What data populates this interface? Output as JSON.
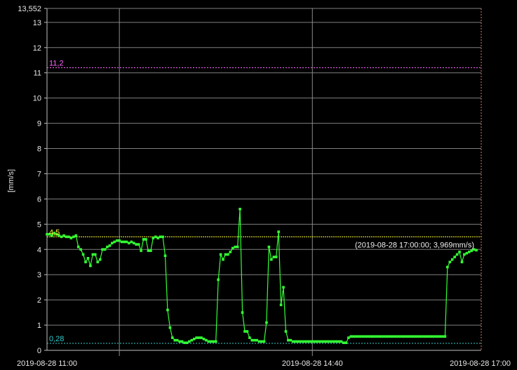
{
  "chart_data": {
    "type": "line",
    "ylabel": "[mm/s]",
    "ylim": [
      0,
      13.552
    ],
    "y_ticks": [
      0,
      1,
      2,
      3,
      4,
      5,
      6,
      7,
      8,
      9,
      10,
      11,
      12,
      13
    ],
    "y_max_label": "13,552",
    "x_range": [
      "2019-08-28 11:00",
      "2019-08-28 17:00"
    ],
    "x_ticks": [
      "2019-08-28 11:00",
      "2019-08-28 14:40",
      "2019-08-28 17:00"
    ],
    "grid": true,
    "thresholds": [
      {
        "label": "11,2",
        "value": 11.2,
        "color": "#ff66ff"
      },
      {
        "label": "4,5",
        "value": 4.5,
        "color": "#ffff33"
      },
      {
        "label": "0,28",
        "value": 0.28,
        "color": "#33cccc"
      }
    ],
    "cursor": {
      "time": "2019-08-28 17:00",
      "label": "(2019-08-28 17:00:00; 3,969mm/s)"
    },
    "series": [
      {
        "color": "#33ff33",
        "x_minutes": [
          0,
          2,
          4,
          6,
          8,
          10,
          12,
          14,
          16,
          18,
          20,
          22,
          24,
          26,
          28,
          30,
          32,
          34,
          36,
          38,
          40,
          42,
          44,
          46,
          48,
          50,
          52,
          54,
          56,
          58,
          60,
          62,
          64,
          66,
          68,
          70,
          72,
          74,
          76,
          78,
          80,
          82,
          84,
          86,
          88,
          90,
          92,
          94,
          96,
          98,
          100,
          102,
          104,
          106,
          108,
          110,
          112,
          114,
          116,
          118,
          120,
          122,
          124,
          126,
          128,
          130,
          132,
          134,
          136,
          138,
          140,
          142,
          144,
          146,
          148,
          150,
          152,
          154,
          156,
          158,
          160,
          162,
          164,
          166,
          168,
          170,
          172,
          174,
          176,
          178,
          180,
          182,
          184,
          186,
          188,
          190,
          192,
          194,
          196,
          198,
          200,
          202,
          204,
          206,
          208,
          210,
          212,
          214,
          216,
          218,
          220,
          222,
          224,
          226,
          228,
          230,
          232,
          234,
          236,
          238,
          240,
          242,
          244,
          246,
          248,
          250,
          252,
          254,
          256,
          258,
          260,
          262,
          264,
          266,
          268,
          270,
          272,
          274,
          276,
          278,
          280,
          282,
          284,
          286,
          288,
          290,
          292,
          294,
          296,
          298,
          300,
          302,
          304,
          306,
          308,
          310,
          312,
          314,
          316,
          318,
          320,
          322,
          324,
          326,
          328,
          330,
          332,
          334,
          336,
          338,
          340,
          342,
          344,
          346,
          348,
          350,
          352,
          354,
          356,
          358,
          360
        ],
        "values": [
          4.6,
          4.6,
          4.55,
          4.65,
          4.6,
          4.55,
          4.5,
          4.55,
          4.5,
          4.5,
          4.45,
          4.5,
          4.55,
          4.1,
          4.0,
          3.8,
          3.5,
          3.65,
          3.35,
          3.8,
          3.8,
          3.5,
          3.6,
          4.0,
          4.0,
          4.1,
          4.15,
          4.25,
          4.3,
          4.35,
          4.35,
          4.3,
          4.3,
          4.3,
          4.25,
          4.3,
          4.25,
          4.2,
          4.2,
          3.95,
          4.4,
          4.4,
          3.95,
          3.95,
          4.45,
          4.5,
          4.45,
          4.5,
          4.5,
          3.75,
          1.6,
          0.9,
          0.5,
          0.4,
          0.4,
          0.35,
          0.35,
          0.3,
          0.3,
          0.35,
          0.4,
          0.45,
          0.5,
          0.5,
          0.5,
          0.45,
          0.4,
          0.35,
          0.35,
          0.35,
          0.35,
          2.8,
          3.8,
          3.6,
          3.8,
          3.8,
          3.9,
          4.05,
          4.1,
          4.1,
          5.6,
          1.5,
          0.75,
          0.75,
          0.5,
          0.4,
          0.4,
          0.4,
          0.35,
          0.35,
          0.35,
          1.1,
          4.1,
          3.6,
          3.7,
          3.7,
          4.7,
          1.8,
          2.5,
          0.75,
          0.4,
          0.4,
          0.35,
          0.35,
          0.35,
          0.35,
          0.35,
          0.35,
          0.35,
          0.35,
          0.35,
          0.35,
          0.35,
          0.35,
          0.35,
          0.35,
          0.35,
          0.35,
          0.35,
          0.35,
          0.35,
          0.35,
          0.35,
          0.3,
          0.3,
          0.5,
          0.55,
          0.55,
          0.55,
          0.55,
          0.55,
          0.55,
          0.55,
          0.55,
          0.55,
          0.55,
          0.55,
          0.55,
          0.55,
          0.55,
          0.55,
          0.55,
          0.55,
          0.55,
          0.55,
          0.55,
          0.55,
          0.55,
          0.55,
          0.55,
          0.55,
          0.55,
          0.55,
          0.55,
          0.55,
          0.55,
          0.55,
          0.55,
          0.55,
          0.55,
          0.55,
          0.55,
          0.55,
          0.55,
          0.55,
          0.55,
          3.3,
          3.5,
          3.6,
          3.7,
          3.8,
          3.9,
          3.5,
          3.8,
          3.85,
          3.9,
          3.95,
          4.0,
          3.969
        ]
      }
    ]
  }
}
